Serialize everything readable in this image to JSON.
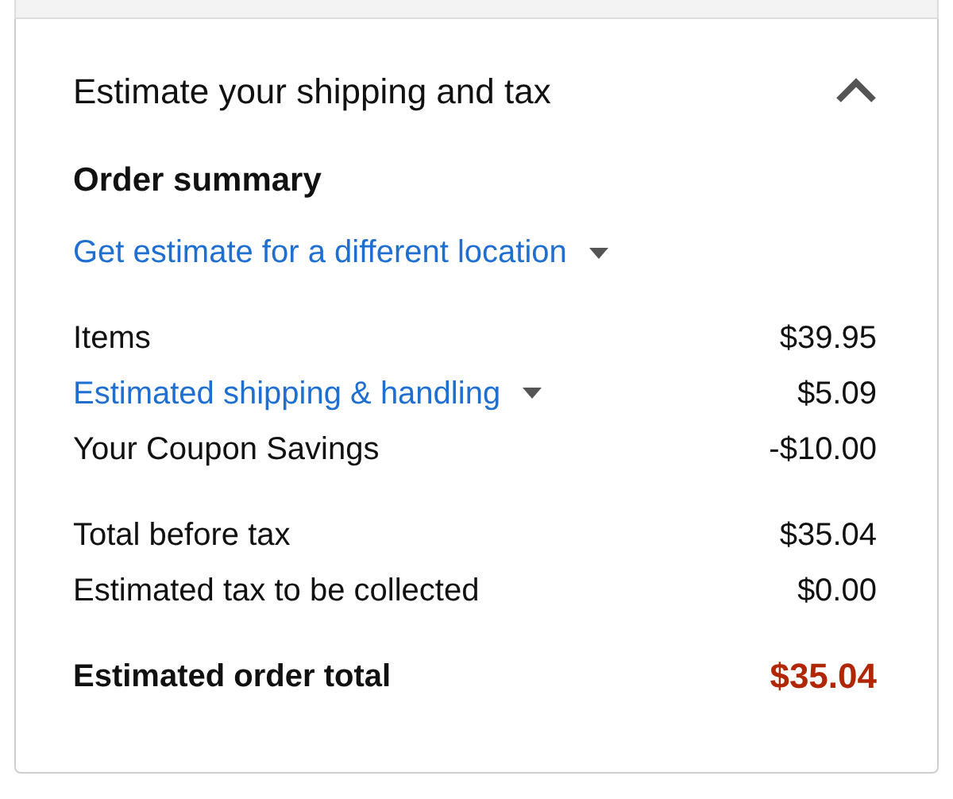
{
  "panel": {
    "title": "Estimate your shipping and tax",
    "expanded": true
  },
  "summary": {
    "heading": "Order summary",
    "location_link": "Get estimate for a different location"
  },
  "groups": [
    {
      "rows": [
        {
          "kind": "plain",
          "label": "Items",
          "amount": "$39.95"
        },
        {
          "kind": "link",
          "label": "Estimated shipping & handling",
          "amount": "$5.09"
        },
        {
          "kind": "plain",
          "label": "Your Coupon Savings",
          "amount": "-$10.00"
        }
      ]
    },
    {
      "rows": [
        {
          "kind": "plain",
          "label": "Total before tax",
          "amount": "$35.04"
        },
        {
          "kind": "plain",
          "label": "Estimated tax to be collected",
          "amount": "$0.00"
        }
      ]
    },
    {
      "rows": [
        {
          "kind": "total",
          "label": "Estimated order total",
          "amount": "$35.04"
        }
      ]
    }
  ]
}
